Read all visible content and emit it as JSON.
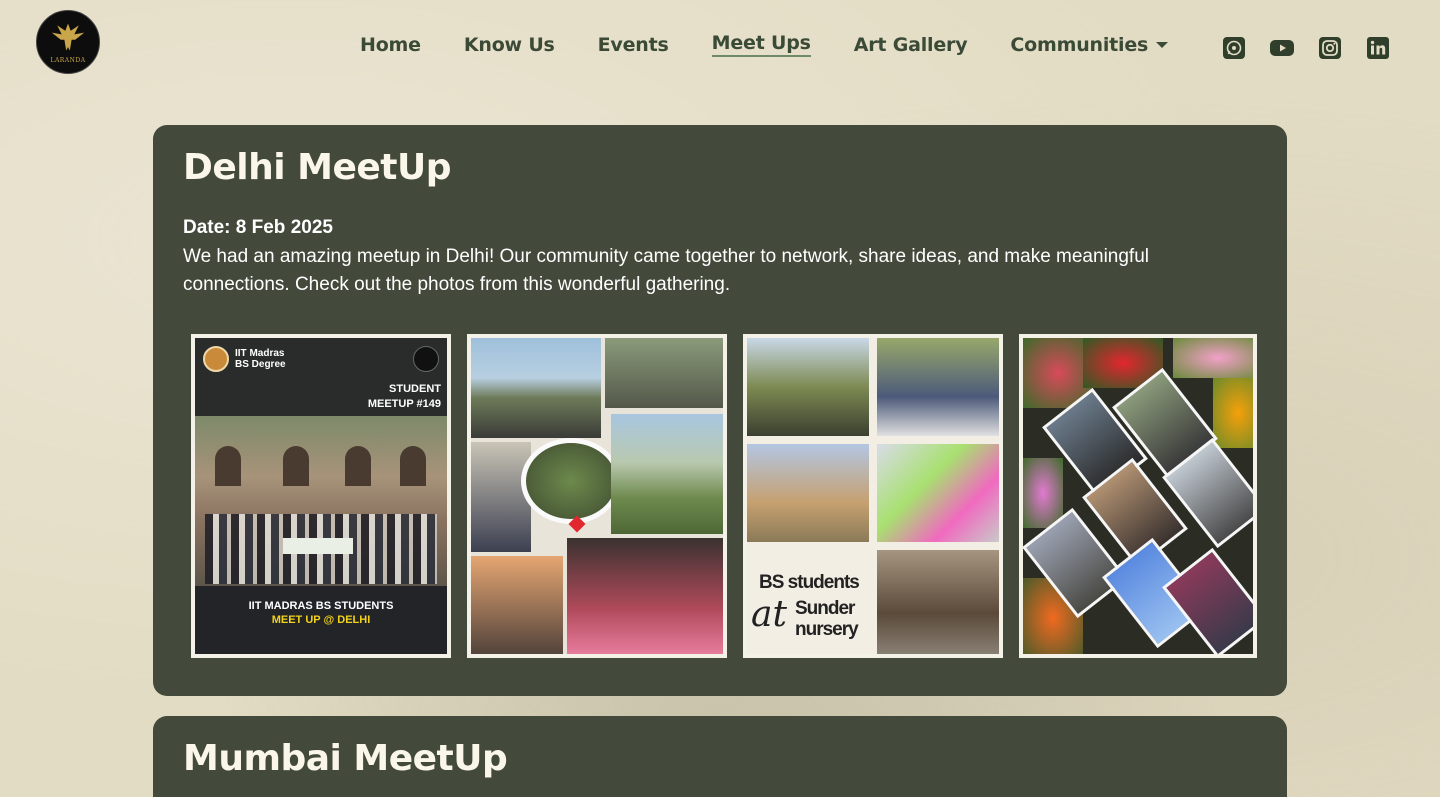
{
  "header": {
    "logo_text": "LARANDA",
    "nav": [
      {
        "label": "Home",
        "active": false
      },
      {
        "label": "Know Us",
        "active": false
      },
      {
        "label": "Events",
        "active": false
      },
      {
        "label": "Meet Ups",
        "active": true
      },
      {
        "label": "Art Gallery",
        "active": false
      },
      {
        "label": "Communities",
        "active": false,
        "dropdown": true
      }
    ],
    "socials": [
      "whatsapp-icon",
      "youtube-icon",
      "instagram-icon",
      "linkedin-icon"
    ]
  },
  "meetups": [
    {
      "title": "Delhi MeetUp",
      "date": "Date: 8 Feb 2025",
      "description": "We had an amazing meetup in Delhi!  Our community came together to network, share ideas, and make meaningful connections. Check out the photos from this wonderful gathering.",
      "photo1": {
        "uni_line1": "IIT Madras",
        "uni_line2": "BS Degree",
        "meet_line1": "STUDENT",
        "meet_line2": "MEETUP #149",
        "caption_line1": "IIT MADRAS BS STUDENTS",
        "caption_line2": "MEET UP @ DELHI"
      },
      "photo3": {
        "line1": "BS students",
        "line2": "at",
        "line3": "Sunder",
        "line4": "nursery"
      }
    },
    {
      "title": "Mumbai MeetUp"
    }
  ],
  "colors": {
    "page_bg": "#e3dcc4",
    "card_bg": "#434a3b",
    "nav_text": "#3a4a36",
    "accent_yellow": "#f2d21b"
  }
}
